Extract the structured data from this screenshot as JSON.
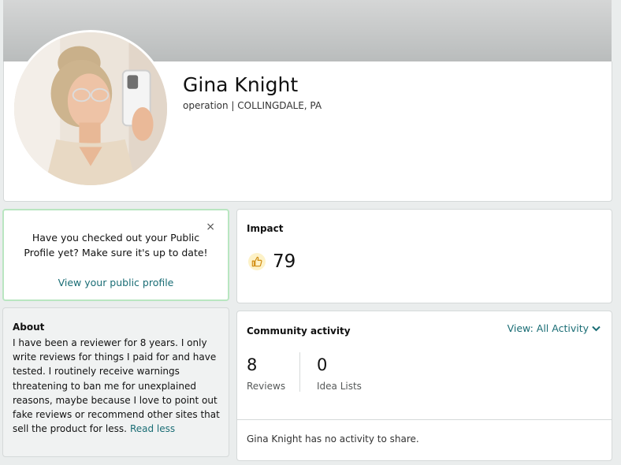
{
  "profile": {
    "name": "Gina Knight",
    "subtitle": "operation | COLLINGDALE, PA"
  },
  "promo": {
    "message": "Have you checked out your Public Profile yet? Make sure it's up to date!",
    "link_label": "View your public profile",
    "close_glyph": "×"
  },
  "about": {
    "title": "About",
    "body": "I have been a reviewer for 8 years. I only write reviews for things I paid for and have tested. I routinely receive warnings threatening to ban me for unexplained reasons, maybe because I love to point out fake reviews or recommend other sites that sell the product for less.",
    "toggle_label": "Read less"
  },
  "impact": {
    "title": "Impact",
    "value": "79",
    "icon": "thumbs-up-icon"
  },
  "community": {
    "title": "Community activity",
    "view_label": "View:",
    "view_value": "All Activity",
    "stats": [
      {
        "value": "8",
        "label": "Reviews"
      },
      {
        "value": "0",
        "label": "Idea Lists"
      }
    ],
    "empty_message": "Gina Knight has no activity to share."
  },
  "colors": {
    "link": "#1a6d75",
    "promo_border": "#b9e6c1",
    "banner": "#c4c6c6"
  }
}
